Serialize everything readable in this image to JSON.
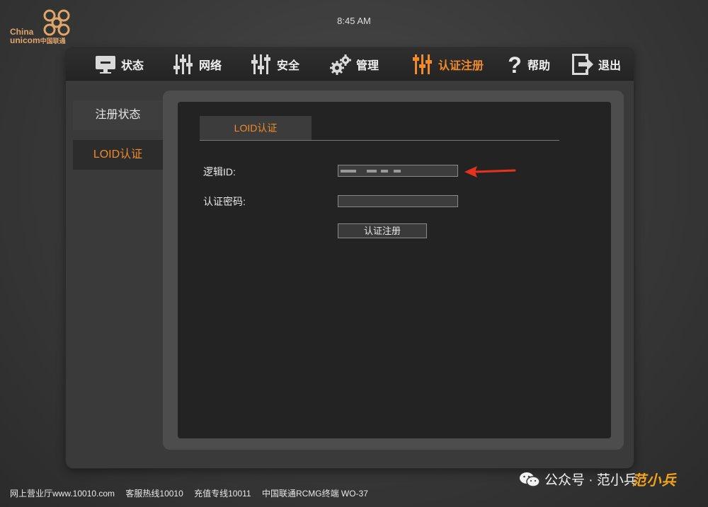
{
  "header": {
    "time": "8:45 AM",
    "logo": {
      "line1": "China",
      "line2": "unicom",
      "line2_cn": "中国联通"
    }
  },
  "nav": {
    "items": [
      {
        "label": "状态",
        "icon": "monitor-icon"
      },
      {
        "label": "网络",
        "icon": "sliders-icon"
      },
      {
        "label": "安全",
        "icon": "sliders-icon"
      },
      {
        "label": "管理",
        "icon": "gears-icon"
      },
      {
        "label": "认证注册",
        "icon": "sliders-icon",
        "active": true
      },
      {
        "label": "帮助",
        "icon": "question-icon"
      },
      {
        "label": "退出",
        "icon": "exit-icon"
      }
    ]
  },
  "sidebar": {
    "items": [
      {
        "label": "注册状态"
      },
      {
        "label": "LOID认证",
        "active": true
      }
    ]
  },
  "content": {
    "tab_label": "LOID认证",
    "form": {
      "loid_label": "逻辑ID:",
      "loid_value": "",
      "password_label": "认证密码:",
      "password_value": "",
      "submit_label": "认证注册"
    }
  },
  "footer": {
    "items": [
      "网上营业厅www.10010.com",
      "客服热线10010",
      "充值专线10011",
      "中国联通RCMG终端 WO-37"
    ]
  },
  "watermark": {
    "text": "公众号 · 范小兵",
    "badge": "范小兵"
  },
  "colors": {
    "accent": "#f08a2a",
    "annotation_arrow": "#e8321e",
    "logo": "#e0a56a"
  }
}
